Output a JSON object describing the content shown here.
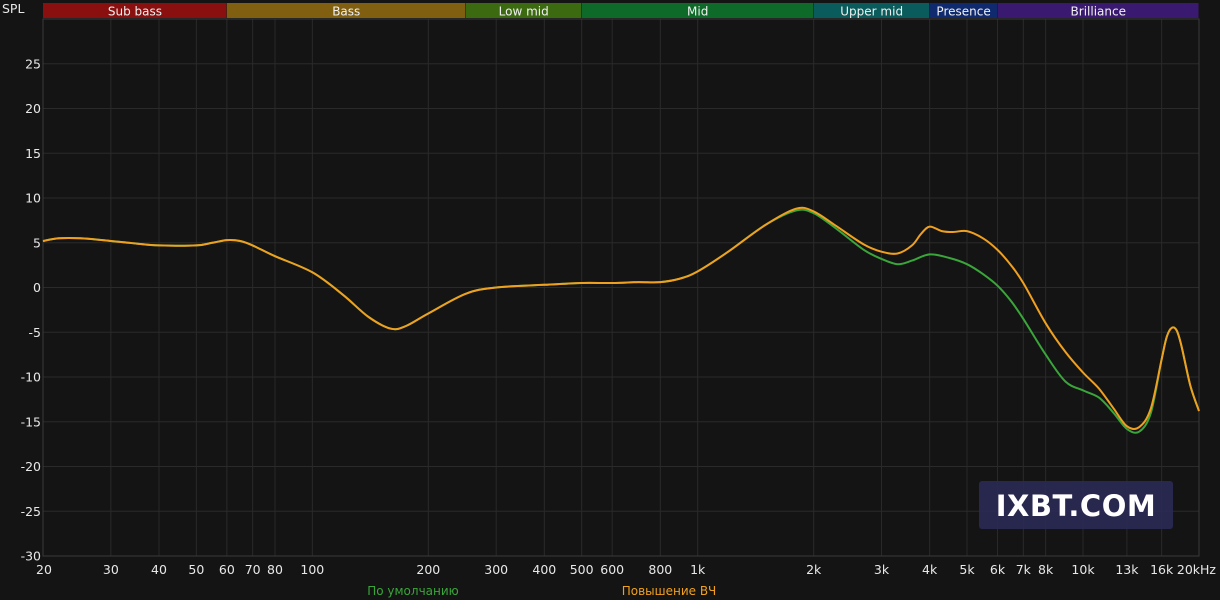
{
  "chart_data": {
    "type": "line",
    "y_axis_label": "SPL",
    "x_scale": "log",
    "xlim": [
      20,
      20000
    ],
    "ylim": [
      -30,
      30
    ],
    "y_ticks": [
      25,
      20,
      15,
      10,
      5,
      0,
      -5,
      -10,
      -15,
      -20,
      -25,
      -30
    ],
    "x_ticks": [
      {
        "v": 20,
        "label": "20"
      },
      {
        "v": 30,
        "label": "30"
      },
      {
        "v": 40,
        "label": "40"
      },
      {
        "v": 50,
        "label": "50"
      },
      {
        "v": 60,
        "label": "60"
      },
      {
        "v": 70,
        "label": "70"
      },
      {
        "v": 80,
        "label": "80"
      },
      {
        "v": 100,
        "label": "100"
      },
      {
        "v": 200,
        "label": "200"
      },
      {
        "v": 300,
        "label": "300"
      },
      {
        "v": 400,
        "label": "400"
      },
      {
        "v": 500,
        "label": "500"
      },
      {
        "v": 600,
        "label": "600"
      },
      {
        "v": 800,
        "label": "800"
      },
      {
        "v": 1000,
        "label": "1k"
      },
      {
        "v": 2000,
        "label": "2k"
      },
      {
        "v": 3000,
        "label": "3k"
      },
      {
        "v": 4000,
        "label": "4k"
      },
      {
        "v": 5000,
        "label": "5k"
      },
      {
        "v": 6000,
        "label": "6k"
      },
      {
        "v": 7000,
        "label": "7k"
      },
      {
        "v": 8000,
        "label": "8k"
      },
      {
        "v": 10000,
        "label": "10k"
      },
      {
        "v": 13000,
        "label": "13k"
      },
      {
        "v": 16000,
        "label": "16k"
      },
      {
        "v": 20000,
        "label": "20kHz"
      }
    ],
    "dim_tick_labels": [
      "13k",
      "16k"
    ],
    "bands": [
      {
        "name": "Sub bass",
        "from": 20,
        "to": 60,
        "color": "#8a1010"
      },
      {
        "name": "Bass",
        "from": 60,
        "to": 250,
        "color": "#806010"
      },
      {
        "name": "Low mid",
        "from": 250,
        "to": 500,
        "color": "#3c6a10"
      },
      {
        "name": "Mid",
        "from": 500,
        "to": 2000,
        "color": "#0e6a28"
      },
      {
        "name": "Upper mid",
        "from": 2000,
        "to": 4000,
        "color": "#0a5c5c"
      },
      {
        "name": "Presence",
        "from": 4000,
        "to": 6000,
        "color": "#102a70"
      },
      {
        "name": "Brilliance",
        "from": 6000,
        "to": 20000,
        "color": "#3a1a70"
      }
    ],
    "series": [
      {
        "name": "По умолчанию",
        "color": "#3aa53a",
        "points": [
          [
            20,
            5.2
          ],
          [
            22,
            5.5
          ],
          [
            25,
            5.5
          ],
          [
            30,
            5.2
          ],
          [
            35,
            4.9
          ],
          [
            40,
            4.7
          ],
          [
            50,
            4.7
          ],
          [
            55,
            5.0
          ],
          [
            60,
            5.3
          ],
          [
            65,
            5.2
          ],
          [
            70,
            4.7
          ],
          [
            80,
            3.5
          ],
          [
            100,
            1.7
          ],
          [
            120,
            -0.8
          ],
          [
            140,
            -3.3
          ],
          [
            160,
            -4.6
          ],
          [
            175,
            -4.3
          ],
          [
            200,
            -2.9
          ],
          [
            250,
            -0.7
          ],
          [
            300,
            0.0
          ],
          [
            400,
            0.3
          ],
          [
            500,
            0.5
          ],
          [
            600,
            0.5
          ],
          [
            700,
            0.6
          ],
          [
            800,
            0.6
          ],
          [
            900,
            1.0
          ],
          [
            1000,
            1.8
          ],
          [
            1200,
            4.0
          ],
          [
            1500,
            7.0
          ],
          [
            1800,
            8.6
          ],
          [
            2000,
            8.3
          ],
          [
            2300,
            6.5
          ],
          [
            2700,
            4.2
          ],
          [
            3000,
            3.2
          ],
          [
            3300,
            2.6
          ],
          [
            3600,
            3.0
          ],
          [
            4000,
            3.7
          ],
          [
            4500,
            3.3
          ],
          [
            5000,
            2.6
          ],
          [
            5500,
            1.5
          ],
          [
            6000,
            0.2
          ],
          [
            6500,
            -1.5
          ],
          [
            7000,
            -3.5
          ],
          [
            8000,
            -7.5
          ],
          [
            9000,
            -10.5
          ],
          [
            10000,
            -11.5
          ],
          [
            11000,
            -12.3
          ],
          [
            12000,
            -14.0
          ],
          [
            13000,
            -15.8
          ],
          [
            14000,
            -16.1
          ],
          [
            15000,
            -14.0
          ],
          [
            16000,
            -8.0
          ],
          [
            16500,
            -5.5
          ],
          [
            17000,
            -4.5
          ],
          [
            17500,
            -4.8
          ],
          [
            18000,
            -6.5
          ],
          [
            19000,
            -11.0
          ],
          [
            20000,
            -13.8
          ]
        ]
      },
      {
        "name": "Повышение ВЧ",
        "color": "#f0a020",
        "points": [
          [
            20,
            5.2
          ],
          [
            22,
            5.5
          ],
          [
            25,
            5.5
          ],
          [
            30,
            5.2
          ],
          [
            35,
            4.9
          ],
          [
            40,
            4.7
          ],
          [
            50,
            4.7
          ],
          [
            55,
            5.0
          ],
          [
            60,
            5.3
          ],
          [
            65,
            5.2
          ],
          [
            70,
            4.7
          ],
          [
            80,
            3.5
          ],
          [
            100,
            1.7
          ],
          [
            120,
            -0.8
          ],
          [
            140,
            -3.3
          ],
          [
            160,
            -4.6
          ],
          [
            175,
            -4.3
          ],
          [
            200,
            -2.9
          ],
          [
            250,
            -0.7
          ],
          [
            300,
            0.0
          ],
          [
            400,
            0.3
          ],
          [
            500,
            0.5
          ],
          [
            600,
            0.5
          ],
          [
            700,
            0.6
          ],
          [
            800,
            0.6
          ],
          [
            900,
            1.0
          ],
          [
            1000,
            1.8
          ],
          [
            1200,
            4.0
          ],
          [
            1500,
            7.0
          ],
          [
            1800,
            8.8
          ],
          [
            2000,
            8.5
          ],
          [
            2300,
            6.8
          ],
          [
            2700,
            4.8
          ],
          [
            3000,
            4.0
          ],
          [
            3300,
            3.8
          ],
          [
            3600,
            4.7
          ],
          [
            3800,
            6.0
          ],
          [
            4000,
            6.8
          ],
          [
            4300,
            6.3
          ],
          [
            4600,
            6.2
          ],
          [
            5000,
            6.3
          ],
          [
            5500,
            5.5
          ],
          [
            6000,
            4.2
          ],
          [
            6500,
            2.5
          ],
          [
            7000,
            0.5
          ],
          [
            8000,
            -4.0
          ],
          [
            9000,
            -7.2
          ],
          [
            10000,
            -9.5
          ],
          [
            11000,
            -11.3
          ],
          [
            12000,
            -13.5
          ],
          [
            13000,
            -15.5
          ],
          [
            14000,
            -15.6
          ],
          [
            15000,
            -13.5
          ],
          [
            16000,
            -8.0
          ],
          [
            16500,
            -5.5
          ],
          [
            17000,
            -4.5
          ],
          [
            17500,
            -4.8
          ],
          [
            18000,
            -6.5
          ],
          [
            19000,
            -11.0
          ],
          [
            20000,
            -13.8
          ]
        ]
      }
    ]
  },
  "watermark": "IXBT.COM"
}
